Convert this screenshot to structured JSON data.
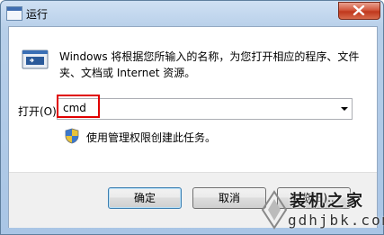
{
  "window": {
    "title": "运行"
  },
  "dialog": {
    "description": "Windows 将根据您所输入的名称，为您打开相应的程序、文件夹、文档或 Internet 资源。",
    "open_label": "打开(O):",
    "input_value": "cmd",
    "admin_note": "使用管理权限创建此任务。"
  },
  "buttons": {
    "ok": "确定",
    "cancel": "取消",
    "browse": "浏览(B)..."
  },
  "watermark": {
    "title": "装机之家",
    "url": "gdhjbk.com"
  },
  "colors": {
    "highlight": "#e00000",
    "title_bar": "#b7cfe9",
    "close_button": "#c0371c"
  },
  "icons": {
    "window": "run-window-icon",
    "program": "run-program-icon",
    "shield": "uac-shield-icon",
    "close": "close-icon"
  }
}
